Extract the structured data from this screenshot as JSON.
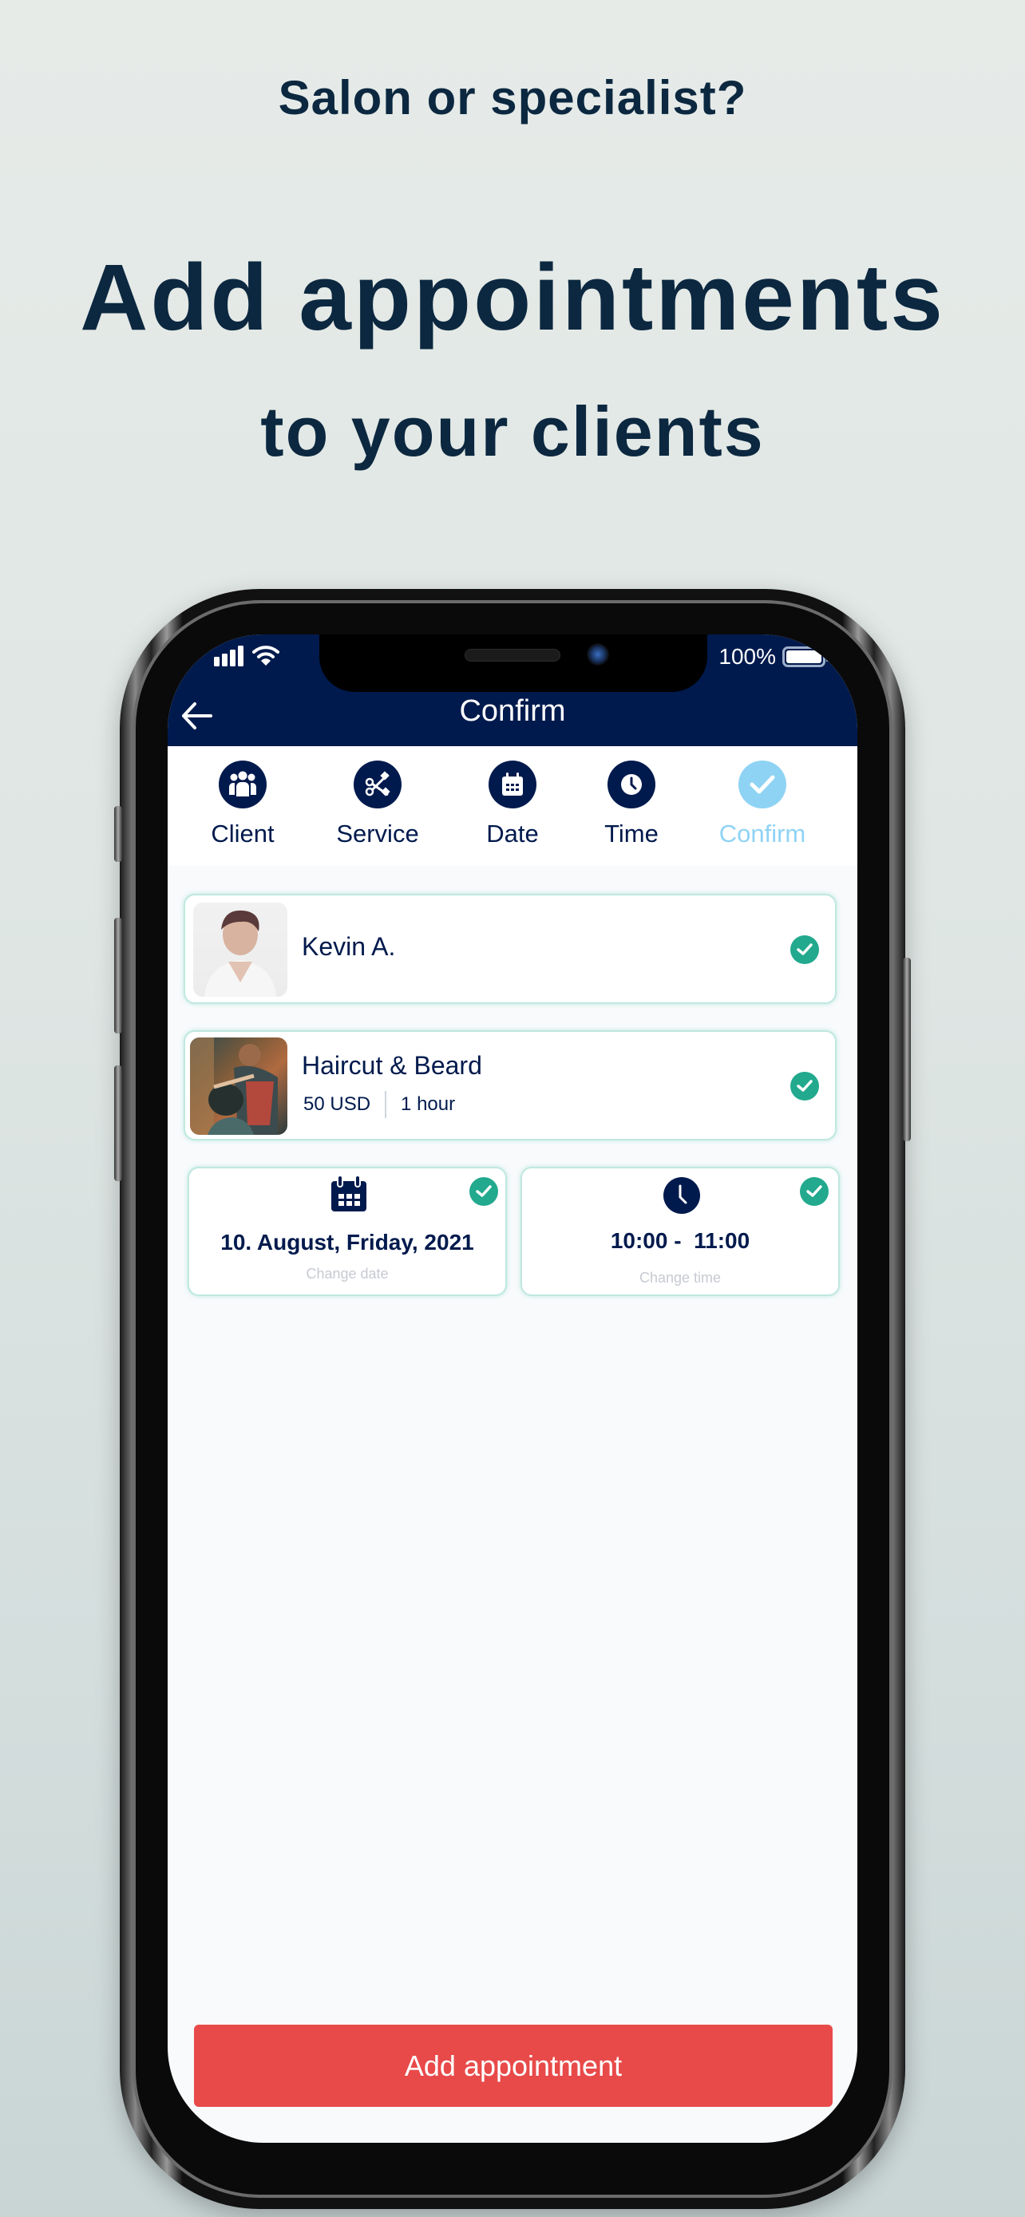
{
  "promo": {
    "subtitle": "Salon or specialist?",
    "title": "Add appointments",
    "title_line2": "to your clients"
  },
  "status_bar": {
    "battery_percent": "100%",
    "battery_level": 1.0,
    "signal_icon": "signal-bars-icon",
    "wifi_icon": "wifi-icon"
  },
  "appbar": {
    "title": "Confirm",
    "back_icon": "arrow-left-icon"
  },
  "stepper": {
    "steps": [
      {
        "label": "Client",
        "icon": "users-icon",
        "state": "done"
      },
      {
        "label": "Service",
        "icon": "scissors-icon",
        "state": "done"
      },
      {
        "label": "Date",
        "icon": "calendar-icon",
        "state": "done"
      },
      {
        "label": "Time",
        "icon": "clock-icon",
        "state": "done"
      },
      {
        "label": "Confirm",
        "icon": "check-icon",
        "state": "active"
      }
    ]
  },
  "client": {
    "name": "Kevin A.",
    "selected": true
  },
  "service": {
    "name": "Haircut & Beard",
    "price": "50 USD",
    "duration": "1 hour",
    "selected": true
  },
  "date": {
    "value": "10. August, Friday, 2021",
    "action": "Change date",
    "selected": true
  },
  "time": {
    "value": "10:00 -  11:00",
    "action": "Change time",
    "selected": true
  },
  "cta": {
    "label": "Add appointment"
  },
  "colors": {
    "primary": "#001a4d",
    "accent_light": "#8fd3f4",
    "success": "#22a98e",
    "cta": "#e84a4a",
    "promo_text": "#0c2840"
  }
}
